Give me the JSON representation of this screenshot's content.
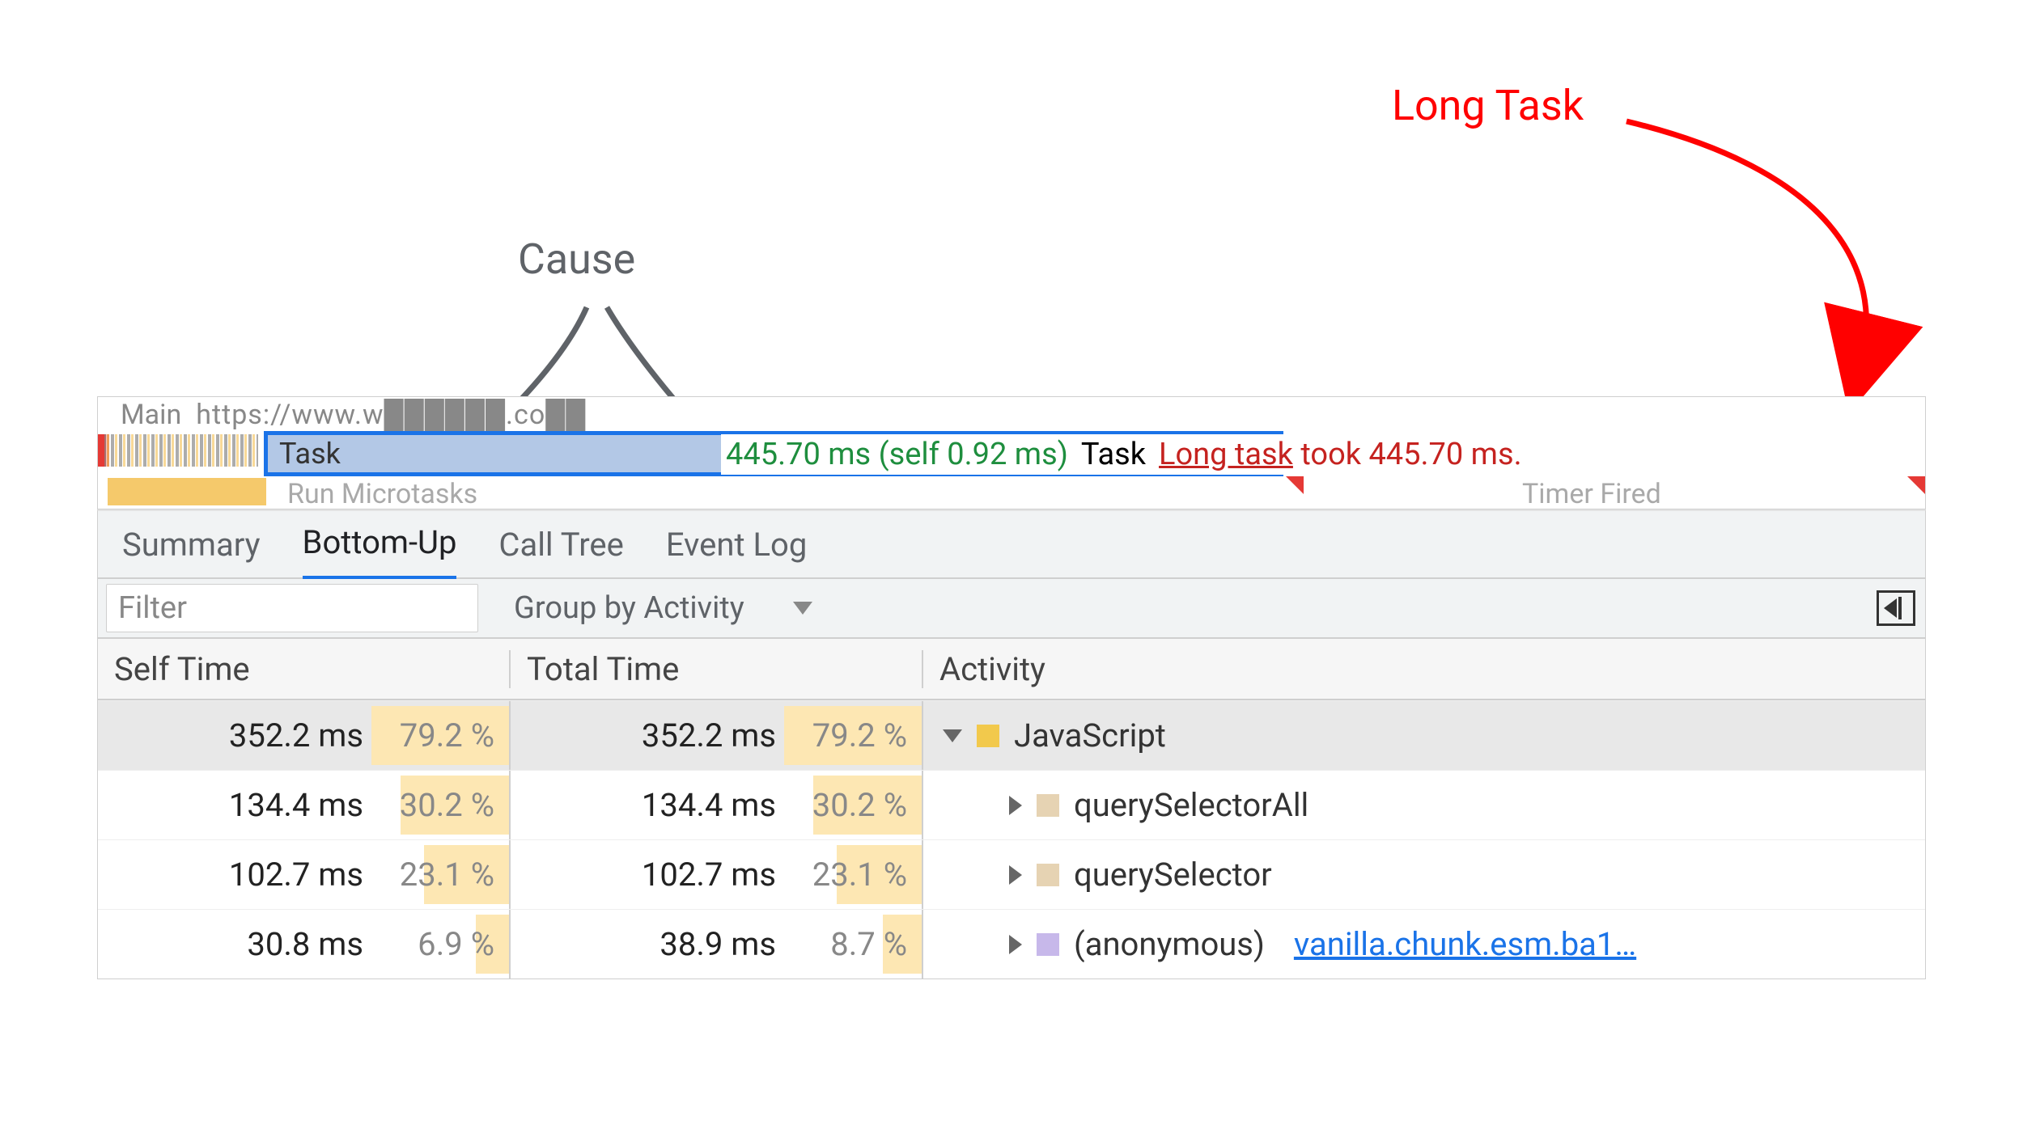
{
  "annotations": {
    "long_task": "Long Task",
    "cause": "Cause"
  },
  "timeline": {
    "main_label": "Main",
    "url_fragment": "https://www.w██████.co██",
    "task_label": "Task",
    "tooltip_time": "445.70 ms (self 0.92 ms)",
    "tooltip_name": "Task",
    "tooltip_long_underlined": "Long task",
    "tooltip_long_rest": " took 445.70 ms.",
    "microtasks_label": "Run Microtasks",
    "timer_fired_label": "Timer Fired"
  },
  "tabs": {
    "summary": "Summary",
    "bottom_up": "Bottom-Up",
    "call_tree": "Call Tree",
    "event_log": "Event Log"
  },
  "filter": {
    "placeholder": "Filter",
    "group_label": "Group by Activity"
  },
  "columns": {
    "self": "Self Time",
    "total": "Total Time",
    "activity": "Activity"
  },
  "rows": [
    {
      "self_ms": "352.2 ms",
      "self_pct": "79.2 %",
      "self_bar": 100,
      "total_ms": "352.2 ms",
      "total_pct": "79.2 %",
      "total_bar": 100,
      "disclosure": "open",
      "indent": 0,
      "swatch": "sw-js",
      "activity": "JavaScript",
      "link": ""
    },
    {
      "self_ms": "134.4 ms",
      "self_pct": "30.2 %",
      "self_bar": 79,
      "total_ms": "134.4 ms",
      "total_pct": "30.2 %",
      "total_bar": 79,
      "disclosure": "closed",
      "indent": 1,
      "swatch": "sw-dom",
      "activity": "querySelectorAll",
      "link": ""
    },
    {
      "self_ms": "102.7 ms",
      "self_pct": "23.1 %",
      "self_bar": 62,
      "total_ms": "102.7 ms",
      "total_pct": "23.1 %",
      "total_bar": 62,
      "disclosure": "closed",
      "indent": 1,
      "swatch": "sw-dom",
      "activity": "querySelector",
      "link": ""
    },
    {
      "self_ms": "30.8 ms",
      "self_pct": "6.9 %",
      "self_bar": 24,
      "total_ms": "38.9 ms",
      "total_pct": "8.7 %",
      "total_bar": 28,
      "disclosure": "closed",
      "indent": 1,
      "swatch": "sw-anon",
      "activity": "(anonymous)",
      "link": "vanilla.chunk.esm.ba1…"
    }
  ]
}
